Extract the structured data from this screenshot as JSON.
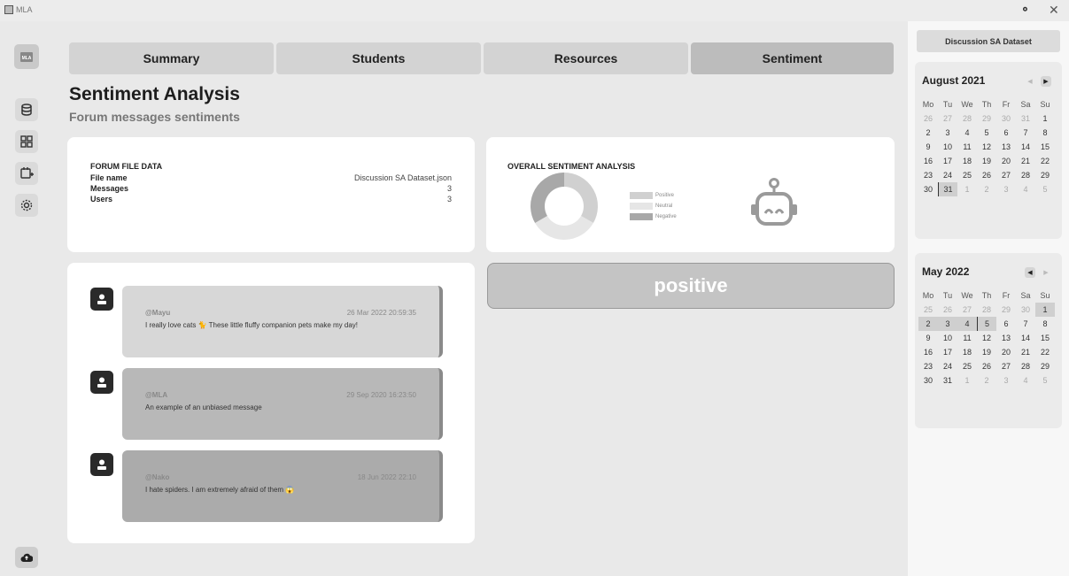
{
  "window": {
    "title": "MLA",
    "min_icon": "minimize-icon",
    "close_icon": "close-icon"
  },
  "sidebar": {
    "logo_text": "MLA",
    "items": [
      {
        "icon": "database-icon"
      },
      {
        "icon": "dashboard-icon"
      },
      {
        "icon": "calendar-add-icon"
      },
      {
        "icon": "settings-icon"
      }
    ],
    "upload_icon": "cloud-upload-icon"
  },
  "tabs": [
    {
      "label": "Summary",
      "active": false
    },
    {
      "label": "Students",
      "active": false
    },
    {
      "label": "Resources",
      "active": false
    },
    {
      "label": "Sentiment",
      "active": true
    }
  ],
  "page": {
    "title": "Sentiment Analysis",
    "subtitle": "Forum messages sentiments"
  },
  "file_data": {
    "title": "FORUM FILE DATA",
    "rows": [
      {
        "label": "File name",
        "value": "Discussion SA Dataset.json"
      },
      {
        "label": "Messages",
        "value": "3"
      },
      {
        "label": "Users",
        "value": "3"
      }
    ]
  },
  "sentiment_overview": {
    "title": "OVERALL SENTIMENT ANALYSIS",
    "legend": [
      {
        "label": "Positive",
        "color": "#d0d0d0"
      },
      {
        "label": "Neutral",
        "color": "#e6e6e6"
      },
      {
        "label": "Negative",
        "color": "#a8a8a8"
      }
    ],
    "donut_values": [
      1,
      1,
      1
    ],
    "robot_icon": "robot-icon"
  },
  "messages": [
    {
      "user": "@Mayu",
      "time": "26 Mar 2022 20:59:35",
      "text": "I really love cats 🐈 These little fluffy companion pets make my day!",
      "color": "#d7d7d7"
    },
    {
      "user": "@MLA",
      "time": "29 Sep 2020 16:23:50",
      "text": "An example of an unbiased message",
      "color": "#b8b8b8"
    },
    {
      "user": "@Nako",
      "time": "18 Jun 2022 22:10",
      "text": "I hate spiders. I am extremely afraid of them 😱",
      "color": "#ababab"
    }
  ],
  "result": {
    "label": "positive"
  },
  "right_panel": {
    "dataset_button": "Discussion SA Dataset",
    "calendars": [
      {
        "title": "August 2021",
        "weekdays": [
          "Mo",
          "Tu",
          "We",
          "Th",
          "Fr",
          "Sa",
          "Su"
        ],
        "weeks": [
          [
            "26",
            "27",
            "28",
            "29",
            "30",
            "31",
            "1"
          ],
          [
            "2",
            "3",
            "4",
            "5",
            "6",
            "7",
            "8"
          ],
          [
            "9",
            "10",
            "11",
            "12",
            "13",
            "14",
            "15"
          ],
          [
            "16",
            "17",
            "18",
            "19",
            "20",
            "21",
            "22"
          ],
          [
            "23",
            "24",
            "25",
            "26",
            "27",
            "28",
            "29"
          ],
          [
            "30",
            "31",
            "1",
            "2",
            "3",
            "4",
            "5"
          ]
        ],
        "leading_muted": 6,
        "trailing_muted": 5,
        "selected": [
          "31"
        ],
        "today": "31"
      },
      {
        "title": "May 2022",
        "weekdays": [
          "Mo",
          "Tu",
          "We",
          "Th",
          "Fr",
          "Sa",
          "Su"
        ],
        "weeks": [
          [
            "25",
            "26",
            "27",
            "28",
            "29",
            "30",
            "1"
          ],
          [
            "2",
            "3",
            "4",
            "5",
            "6",
            "7",
            "8"
          ],
          [
            "9",
            "10",
            "11",
            "12",
            "13",
            "14",
            "15"
          ],
          [
            "16",
            "17",
            "18",
            "19",
            "20",
            "21",
            "22"
          ],
          [
            "23",
            "24",
            "25",
            "26",
            "27",
            "28",
            "29"
          ],
          [
            "30",
            "31",
            "1",
            "2",
            "3",
            "4",
            "5"
          ]
        ],
        "leading_muted": 6,
        "trailing_muted": 5,
        "selected": [
          "1",
          "2",
          "3",
          "4",
          "5"
        ],
        "today": "5"
      }
    ]
  }
}
